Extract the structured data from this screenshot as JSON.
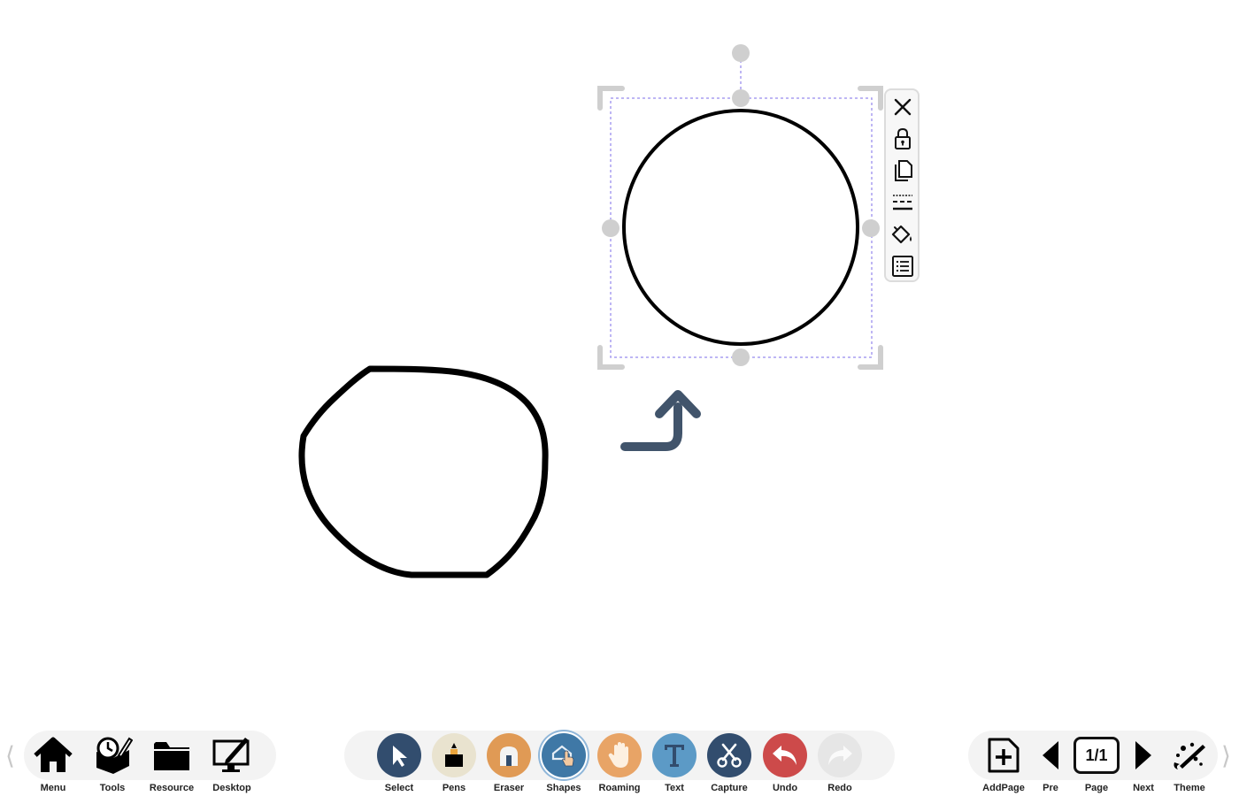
{
  "colors": {
    "select": "#324d6e",
    "pens": "#e9e3cf",
    "eraser": "#e09a55",
    "shapes": "#3f78a6",
    "roaming": "#e8a466",
    "text": "#5c9ac6",
    "capture": "#324d6e",
    "undo": "#cd4a4a",
    "redo": "#e6e6e6",
    "selection_dash": "#a89ef0",
    "handle": "#cfcfcf",
    "connector_arrow": "#41546b"
  },
  "canvas": {
    "objects": [
      "hand-drawn-oval",
      "selected-circle",
      "curved-connector-arrow"
    ]
  },
  "object_panel": {
    "buttons": [
      {
        "name": "close-icon"
      },
      {
        "name": "lock-icon"
      },
      {
        "name": "copy-icon"
      },
      {
        "name": "line-style-icon"
      },
      {
        "name": "fill-bucket-icon"
      },
      {
        "name": "properties-list-icon"
      }
    ]
  },
  "toolbar": {
    "left_arrow": "⟨",
    "right_arrow": "⟩",
    "left": {
      "menu": "Menu",
      "tools": "Tools",
      "resource": "Resource",
      "desktop": "Desktop"
    },
    "center": {
      "select": "Select",
      "pens": "Pens",
      "eraser": "Eraser",
      "shapes": "Shapes",
      "roaming": "Roaming",
      "text": "Text",
      "capture": "Capture",
      "undo": "Undo",
      "redo": "Redo"
    },
    "right": {
      "addpage": "AddPage",
      "pre": "Pre",
      "page": "Page",
      "page_indicator": "1/1",
      "next": "Next",
      "theme": "Theme"
    },
    "active_tool": "shapes"
  }
}
